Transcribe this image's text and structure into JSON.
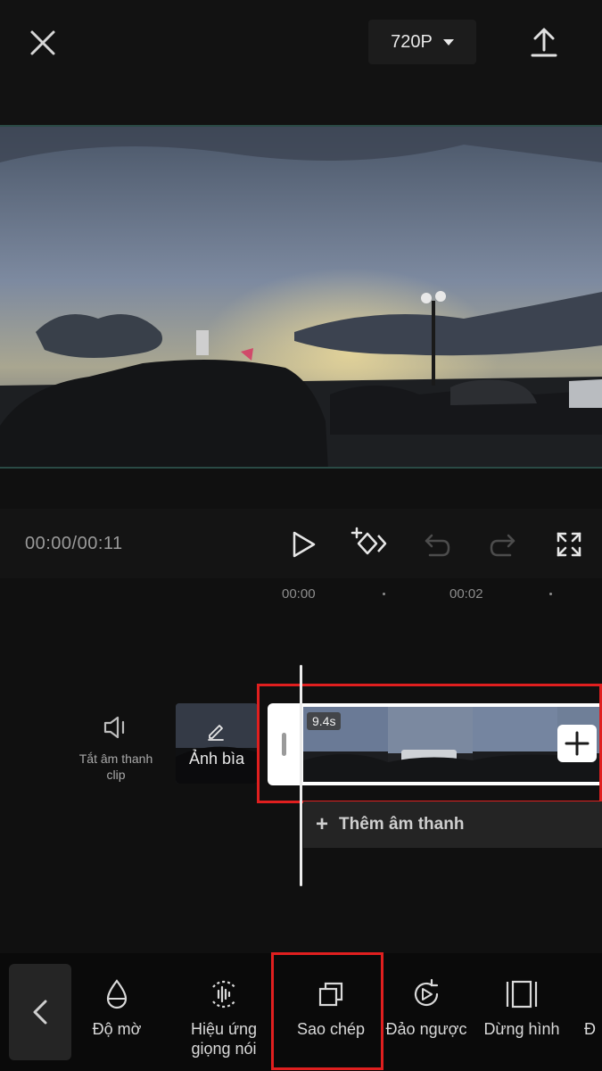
{
  "topbar": {
    "resolution": "720P",
    "close_icon": "close-icon",
    "export_icon": "export-upload-icon"
  },
  "player": {
    "timecode": "00:00/00:11",
    "icons": [
      "play-icon",
      "keyframe-add-icon",
      "undo-icon",
      "redo-icon",
      "fullscreen-icon"
    ]
  },
  "timeline": {
    "ruler": [
      "00:00",
      "00:02"
    ],
    "mute_clip_label": "Tắt âm thanh clip",
    "cover_label": "Ảnh bìa",
    "clip_duration": "9.4s",
    "add_audio_label": "Thêm âm thanh",
    "add_audio_plus": "+"
  },
  "toolbar": {
    "items": [
      {
        "label": "Độ mờ",
        "icon": "opacity-drop-icon"
      },
      {
        "label": "Hiệu ứng giọng nói",
        "icon": "voice-effect-icon"
      },
      {
        "label": "Sao chép",
        "icon": "copy-icon"
      },
      {
        "label": "Đảo ngược",
        "icon": "reverse-icon"
      },
      {
        "label": "Dừng hình",
        "icon": "freeze-frame-icon"
      },
      {
        "label": "Đ",
        "icon": ""
      }
    ]
  },
  "colors": {
    "highlight": "#e01f1f",
    "background": "#101010",
    "panel": "#242424"
  }
}
